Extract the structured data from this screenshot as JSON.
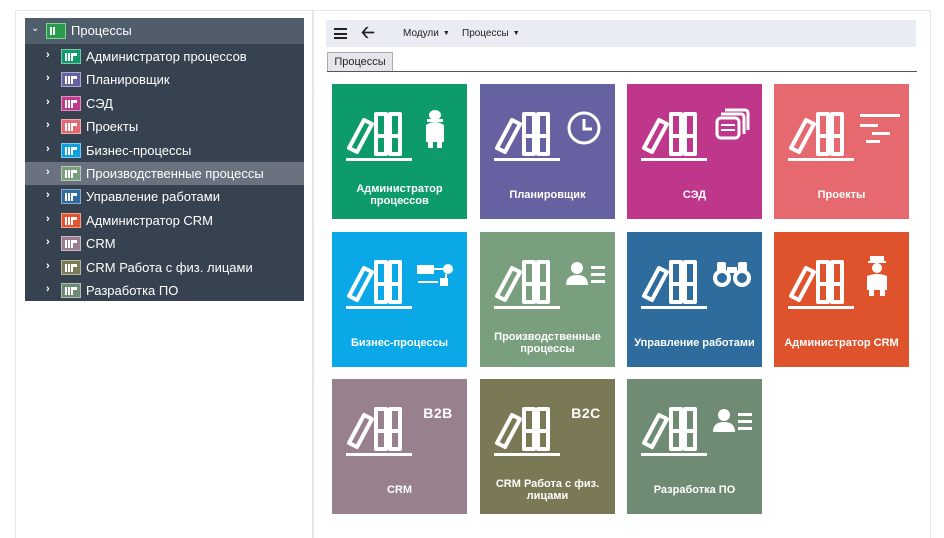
{
  "tree": {
    "root": {
      "label": "Процессы",
      "icon": "folder-green-icon"
    },
    "items": [
      {
        "label": "Администратор процессов",
        "icon": "module-admin-icon",
        "color": "#0f9a6c"
      },
      {
        "label": "Планировщик",
        "icon": "module-scheduler-icon",
        "color": "#6661a0"
      },
      {
        "label": "СЭД",
        "icon": "module-edms-icon",
        "color": "#bf3a8a"
      },
      {
        "label": "Проекты",
        "icon": "module-projects-icon",
        "color": "#e26a72"
      },
      {
        "label": "Бизнес-процессы",
        "icon": "module-bp-icon",
        "color": "#0d9fe0"
      },
      {
        "label": "Производственные процессы",
        "icon": "module-production-icon",
        "color": "#7b9e7e"
      },
      {
        "label": "Управление работами",
        "icon": "module-work-icon",
        "color": "#2f6b9e"
      },
      {
        "label": "Администратор CRM",
        "icon": "module-crm-admin-icon",
        "color": "#e25530"
      },
      {
        "label": "CRM",
        "icon": "module-crm-icon",
        "color": "#9b7d91"
      },
      {
        "label": "CRM Работа с физ. лицами",
        "icon": "module-crm-b2c-icon",
        "color": "#7d7a57"
      },
      {
        "label": "Разработка ПО",
        "icon": "module-dev-icon",
        "color": "#6e8a74"
      }
    ],
    "selected_index": 5
  },
  "toolbar": {
    "menu_icon": "hamburger-icon",
    "back_icon": "arrow-left-icon",
    "modules_label": "Модули",
    "processes_label": "Процессы",
    "caret": "▼"
  },
  "tabs": [
    {
      "label": "Процессы",
      "active": true
    }
  ],
  "tiles": [
    {
      "label": "Администратор процессов",
      "color": "#0d9b6c",
      "icon": "admin-person-icon"
    },
    {
      "label": "Планировщик",
      "color": "#6661a0",
      "icon": "clock-icon"
    },
    {
      "label": "СЭД",
      "color": "#be378a",
      "icon": "documents-stack-icon"
    },
    {
      "label": "Проекты",
      "color": "#e5696e",
      "icon": "gantt-icon"
    },
    {
      "label": "Бизнес-процессы",
      "color": "#0aa8e6",
      "icon": "process-flow-icon"
    },
    {
      "label": "Производственные процессы",
      "color": "#7a9f7f",
      "icon": "contact-card-icon"
    },
    {
      "label": "Управление работами",
      "color": "#2e6c9e",
      "icon": "binoculars-icon"
    },
    {
      "label": "Администратор CRM",
      "color": "#de522c",
      "icon": "doorman-icon"
    },
    {
      "label": "CRM",
      "color": "#98808f",
      "icon": "b2b-badge-icon",
      "badge": "B2B"
    },
    {
      "label": "CRM Работа с физ. лицами",
      "color": "#7b7855",
      "icon": "b2c-badge-icon",
      "badge": "B2C"
    },
    {
      "label": "Разработка ПО",
      "color": "#6f8b73",
      "icon": "contact-card-icon"
    }
  ]
}
